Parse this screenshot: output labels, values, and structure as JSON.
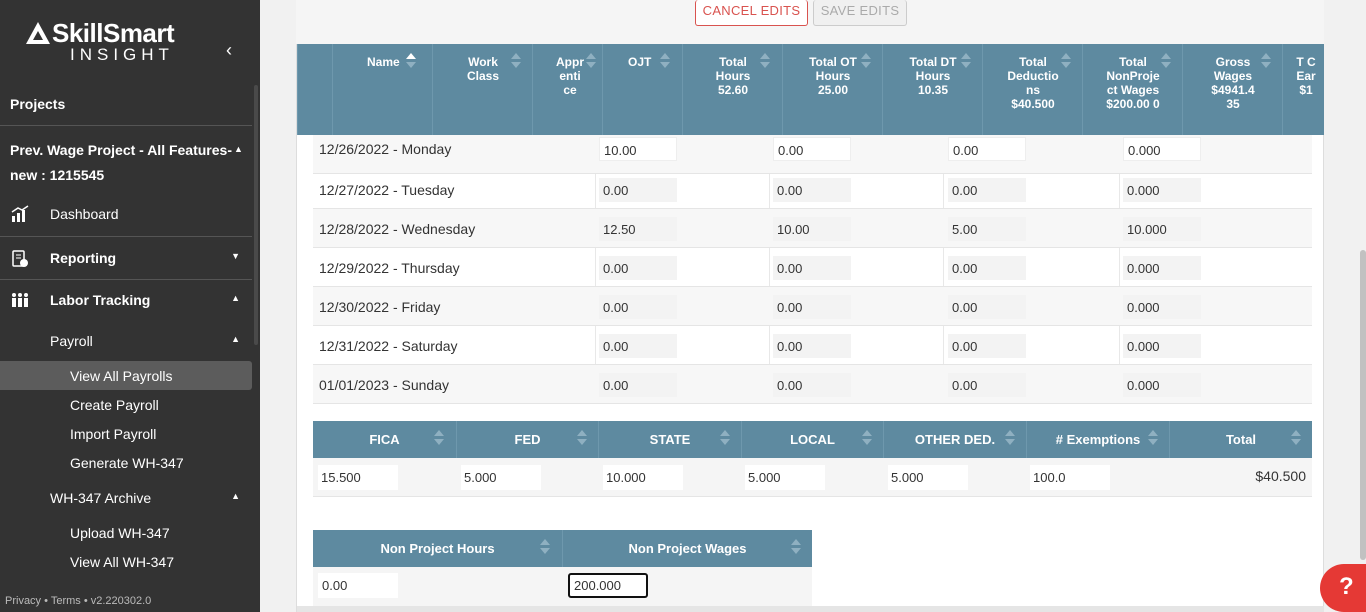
{
  "sidebar": {
    "logo_main": "SkillSmart",
    "logo_sub": "INSIGHT",
    "collapse_glyph": "‹",
    "projects_label": "Projects",
    "project_name_line1": "Prev. Wage Project - All Features-",
    "project_name_line2": "new : 1215545",
    "items": {
      "dashboard": "Dashboard",
      "reporting": "Reporting",
      "labor_tracking": "Labor Tracking",
      "payroll": "Payroll",
      "view_all_payrolls": "View All Payrolls",
      "create_payroll": "Create Payroll",
      "import_payroll": "Import Payroll",
      "generate_wh347": "Generate WH-347",
      "wh347_archive": "WH-347 Archive",
      "upload_wh347": "Upload WH-347",
      "view_all_wh347": "View All WH-347"
    },
    "footer": "Privacy • Terms • v2.220302.0"
  },
  "toolbar": {
    "cancel_label": "CANCEL EDITS",
    "save_label": "SAVE EDITS"
  },
  "header_columns": [
    {
      "label": "Name",
      "sorted": true
    },
    {
      "label": "Work Class"
    },
    {
      "label": "Appr enti ce"
    },
    {
      "label": "OJT"
    },
    {
      "label": "Total Hours 52.60"
    },
    {
      "label": "Total OT Hours 25.00"
    },
    {
      "label": "Total DT Hours 10.35"
    },
    {
      "label": "Total Deductio ns $40.500"
    },
    {
      "label": "Total NonProje ct Wages $200.00 0"
    },
    {
      "label": "Gross Wages $4941.4 35"
    },
    {
      "label": "T C Ear $1"
    }
  ],
  "days": [
    {
      "date": "12/26/2022 - Monday",
      "v1": "10.00",
      "v2": "0.00",
      "v3": "0.00",
      "v4": "0.000"
    },
    {
      "date": "12/27/2022 - Tuesday",
      "v1": "0.00",
      "v2": "0.00",
      "v3": "0.00",
      "v4": "0.000"
    },
    {
      "date": "12/28/2022 - Wednesday",
      "v1": "12.50",
      "v2": "10.00",
      "v3": "5.00",
      "v4": "10.000"
    },
    {
      "date": "12/29/2022 - Thursday",
      "v1": "0.00",
      "v2": "0.00",
      "v3": "0.00",
      "v4": "0.000"
    },
    {
      "date": "12/30/2022 - Friday",
      "v1": "0.00",
      "v2": "0.00",
      "v3": "0.00",
      "v4": "0.000"
    },
    {
      "date": "12/31/2022 - Saturday",
      "v1": "0.00",
      "v2": "0.00",
      "v3": "0.00",
      "v4": "0.000"
    },
    {
      "date": "01/01/2023 - Sunday",
      "v1": "0.00",
      "v2": "0.00",
      "v3": "0.00",
      "v4": "0.000"
    }
  ],
  "deductions": {
    "headers": [
      "FICA",
      "FED",
      "STATE",
      "LOCAL",
      "OTHER DED.",
      "# Exemptions",
      "Total"
    ],
    "values": [
      "15.500",
      "5.000",
      "10.000",
      "5.000",
      "5.000",
      "100.0"
    ],
    "total": "$40.500"
  },
  "non_project": {
    "hours_label": "Non Project Hours",
    "wages_label": "Non Project Wages",
    "hours_value": "0.00",
    "wages_value": "200.000"
  },
  "help_label": "?",
  "colors": {
    "header_bg": "#5e8aa0",
    "sidebar_bg": "#333333",
    "danger": "#d9534f"
  }
}
